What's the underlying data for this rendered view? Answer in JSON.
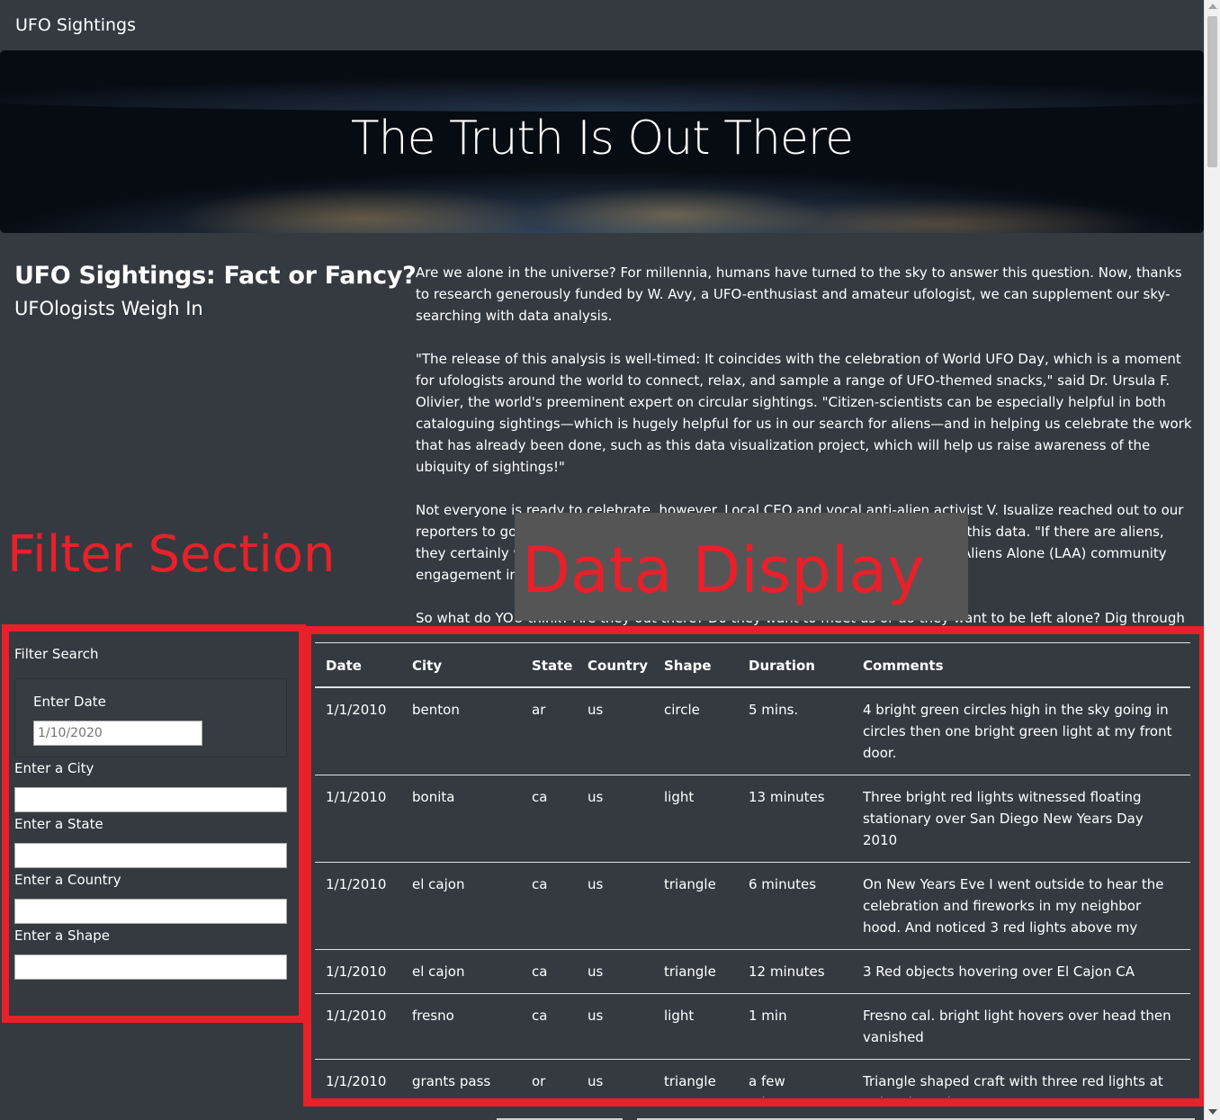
{
  "navbar": {
    "brand": "UFO Sightings"
  },
  "hero": {
    "title": "The Truth Is Out There"
  },
  "article": {
    "headline": "UFO Sightings: Fact or Fancy?",
    "subhead": "UFOlogists Weigh In",
    "paragraphs": [
      "Are we alone in the universe? For millennia, humans have turned to the sky to answer this question. Now, thanks to research generously funded by W. Avy, a UFO-enthusiast and amateur ufologist, we can supplement our sky-searching with data analysis.",
      "\"The release of this analysis is well-timed: It coincides with the celebration of World UFO Day, which is a moment for ufologists around the world to connect, relax, and sample a range of UFO-themed snacks,\" said Dr. Ursula F. Olivier, the world's preeminent expert on circular sightings. \"Citizen-scientists can be especially helpful in both cataloguing sightings—which is hugely helpful for us in our search for aliens—and in helping us celebrate the work that has already been done, such as this data visualization project, which will help us raise awareness of the ubiquity of sightings!\"",
      "Not everyone is ready to celebrate, however. Local CEO and vocal anti-alien activist V. Isualize reached out to our reporters to go on record as firmly opposed to any attempts to provide access to this data. \"If there are aliens, they certainly would rather be left alone, which is why we are leading the Leave Aliens Alone (LAA) community engagement initiative.\"",
      "So what do YOU think? Are they out there? Do they want to meet us or do they want to be left alone? Dig through the data yourself, and let us know what you see."
    ]
  },
  "annotations": {
    "filter_label": "Filter Section",
    "data_label": "Data Display",
    "color": "#e8202a"
  },
  "filters": {
    "title": "Filter Search",
    "date_label": "Enter Date",
    "date_placeholder": "1/10/2020",
    "city_label": "Enter a City",
    "state_label": "Enter a State",
    "country_label": "Enter a Country",
    "shape_label": "Enter a Shape"
  },
  "table": {
    "headers": {
      "date": "Date",
      "city": "City",
      "state": "State",
      "country": "Country",
      "shape": "Shape",
      "duration": "Duration",
      "comments": "Comments"
    },
    "rows": [
      {
        "date": "1/1/2010",
        "city": "benton",
        "state": "ar",
        "country": "us",
        "shape": "circle",
        "duration": "5 mins.",
        "comments": "4 bright green circles high in the sky going in circles then one bright green light at my front door."
      },
      {
        "date": "1/1/2010",
        "city": "bonita",
        "state": "ca",
        "country": "us",
        "shape": "light",
        "duration": "13 minutes",
        "comments": "Three bright red lights witnessed floating stationary over San Diego New Years Day 2010"
      },
      {
        "date": "1/1/2010",
        "city": "el cajon",
        "state": "ca",
        "country": "us",
        "shape": "triangle",
        "duration": "6 minutes",
        "comments": "On New Years Eve I went outside to hear the celebration and fireworks in my neighbor hood. And noticed 3 red lights above my house and"
      },
      {
        "date": "1/1/2010",
        "city": "el cajon",
        "state": "ca",
        "country": "us",
        "shape": "triangle",
        "duration": "12 minutes",
        "comments": "3 Red objects hovering over El Cajon CA"
      },
      {
        "date": "1/1/2010",
        "city": "fresno",
        "state": "ca",
        "country": "us",
        "shape": "light",
        "duration": "1 min",
        "comments": "Fresno cal. bright light hovers over head then vanished"
      },
      {
        "date": "1/1/2010",
        "city": "grants pass",
        "state": "or",
        "country": "us",
        "shape": "triangle",
        "duration": "a few mintues",
        "comments": "Triangle shaped craft with three red lights at points hovering over Grants Pass&#44 Oregon."
      }
    ]
  }
}
